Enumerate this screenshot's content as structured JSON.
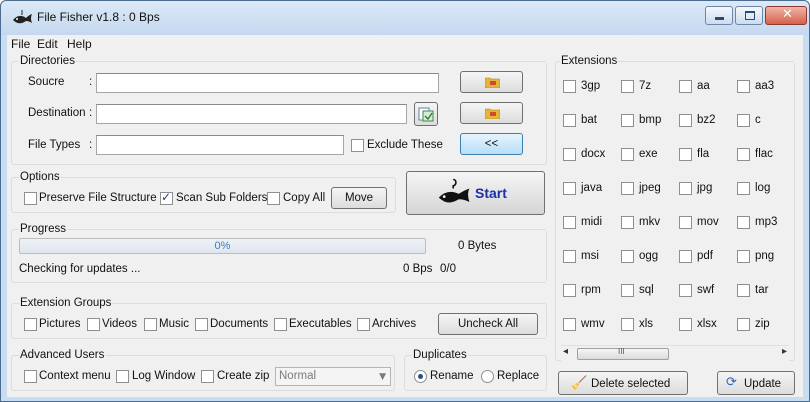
{
  "window": {
    "title": "File Fisher v1.8 : 0 Bps",
    "controls": {
      "minimize": "minimize",
      "maximize": "maximize",
      "close": "close"
    }
  },
  "menu": {
    "items": [
      "File",
      "Edit",
      "Help"
    ]
  },
  "directories": {
    "group_label": "Directories",
    "source_label": "Soucre",
    "destination_label": "Destination",
    "file_types_label": "File Types",
    "colon": ":",
    "source_value": "",
    "destination_value": "",
    "file_types_value": "",
    "exclude_label": "Exclude These",
    "exclude_checked": false,
    "collapse_button": "<<"
  },
  "options": {
    "group_label": "Options",
    "preserve_label": "Preserve File Structure",
    "scan_label": "Scan Sub Folders",
    "copy_all_label": "Copy All",
    "move_button": "Move",
    "preserve_checked": false,
    "scan_checked": true,
    "copy_all_checked": false
  },
  "start": {
    "label": "Start"
  },
  "progress": {
    "group_label": "Progress",
    "percent_text": "0%",
    "percent_value": 0,
    "bytes": "0 Bytes",
    "status": "Checking for updates ...",
    "speed": "0 Bps",
    "count": "0/0"
  },
  "extension_groups": {
    "group_label": "Extension Groups",
    "items": [
      "Pictures",
      "Videos",
      "Music",
      "Documents",
      "Executables",
      "Archives"
    ],
    "uncheck_button": "Uncheck All"
  },
  "advanced": {
    "group_label": "Advanced Users",
    "context_menu_label": "Context menu",
    "log_window_label": "Log Window",
    "create_zip_label": "Create zip",
    "compression_value": "Normal"
  },
  "duplicates": {
    "group_label": "Duplicates",
    "rename_label": "Rename",
    "replace_label": "Replace",
    "selected": "Rename"
  },
  "extensions": {
    "group_label": "Extensions",
    "items": [
      [
        "3gp",
        "7z",
        "aa",
        "aa3"
      ],
      [
        "bat",
        "bmp",
        "bz2",
        "c"
      ],
      [
        "docx",
        "exe",
        "fla",
        "flac"
      ],
      [
        "java",
        "jpeg",
        "jpg",
        "log"
      ],
      [
        "midi",
        "mkv",
        "mov",
        "mp3"
      ],
      [
        "msi",
        "ogg",
        "pdf",
        "png"
      ],
      [
        "rpm",
        "sql",
        "swf",
        "tar"
      ],
      [
        "wmv",
        "xls",
        "xlsx",
        "zip"
      ]
    ],
    "scroll_left": "◂",
    "scroll_right": "▸",
    "scroll_grip": "III"
  },
  "footer": {
    "delete_button": "Delete selected",
    "update_button": "Update"
  },
  "colors": {
    "accent": "#1a2fa8",
    "progress_text": "#3b7bd0",
    "frame": "#c8dcf2"
  }
}
